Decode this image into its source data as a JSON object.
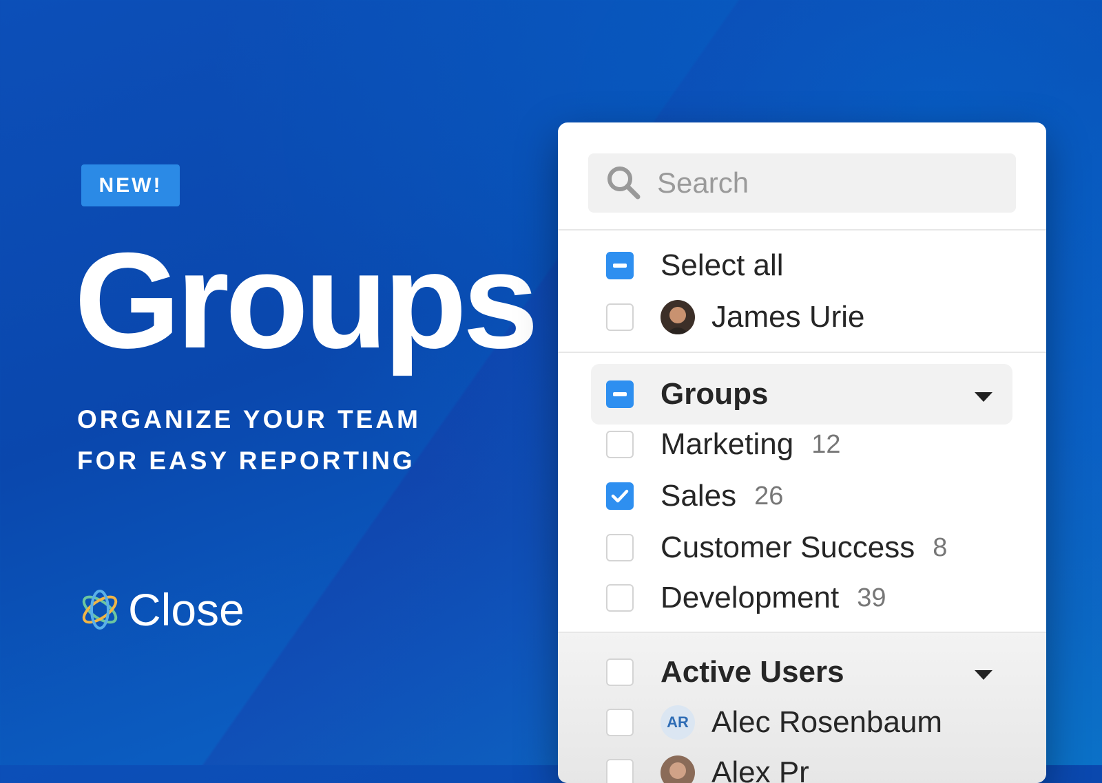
{
  "promo": {
    "badge": "NEW!",
    "title": "Groups",
    "tagline_line1": "ORGANIZE YOUR TEAM",
    "tagline_line2": "FOR EASY REPORTING",
    "brand": "Close"
  },
  "panel": {
    "search": {
      "placeholder": "Search",
      "value": ""
    },
    "select_all": {
      "label": "Select all",
      "state": "indeterminate"
    },
    "james": {
      "label": "James Urie",
      "checked": false
    },
    "groups_section": {
      "label": "Groups",
      "state": "indeterminate"
    },
    "groups": [
      {
        "label": "Marketing",
        "count": "12",
        "checked": false
      },
      {
        "label": "Sales",
        "count": "26",
        "checked": true
      },
      {
        "label": "Customer Success",
        "count": "8",
        "checked": false
      },
      {
        "label": "Development",
        "count": "39",
        "checked": false
      }
    ],
    "active_users_section": {
      "label": "Active Users",
      "checked": false
    },
    "active_users": [
      {
        "label": "Alec Rosenbaum",
        "initials": "AR",
        "checked": false
      },
      {
        "label": "Alex Pr",
        "checked": false
      }
    ]
  },
  "colors": {
    "accent": "#2e8ff0",
    "background": "#0c4fb8",
    "badge": "#2b8ae6"
  }
}
